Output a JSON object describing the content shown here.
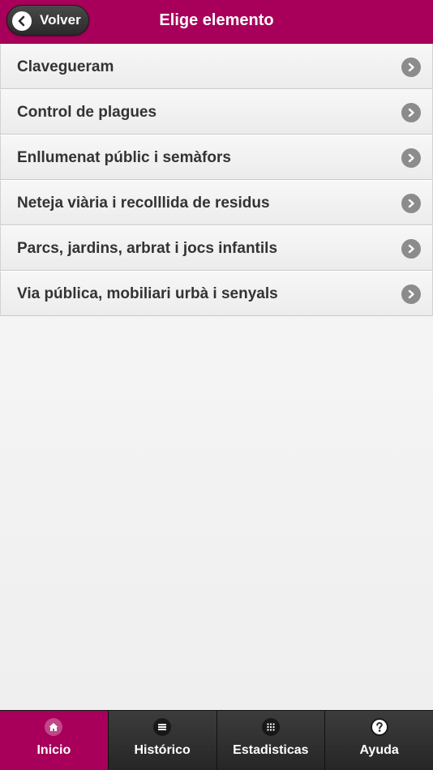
{
  "header": {
    "back_label": "Volver",
    "title": "Elige elemento",
    "accent_color": "#a8005a"
  },
  "list": {
    "items": [
      {
        "label": "Clavegueram",
        "icon": "chevron-right-icon"
      },
      {
        "label": "Control de plagues",
        "icon": "chevron-right-icon"
      },
      {
        "label": "Enllumenat públic i semàfors",
        "icon": "chevron-right-icon"
      },
      {
        "label": "Neteja viària i recolllida de residus",
        "icon": "chevron-right-icon"
      },
      {
        "label": "Parcs, jardins, arbrat i jocs infantils",
        "icon": "chevron-right-icon"
      },
      {
        "label": "Via pública, mobiliari urbà i senyals",
        "icon": "chevron-right-icon"
      }
    ]
  },
  "footer": {
    "tabs": [
      {
        "label": "Inicio",
        "icon": "home-icon",
        "active": true
      },
      {
        "label": "Histórico",
        "icon": "list-icon",
        "active": false
      },
      {
        "label": "Estadisticas",
        "icon": "grid-icon",
        "active": false
      },
      {
        "label": "Ayuda",
        "icon": "help-icon",
        "active": false
      }
    ]
  }
}
